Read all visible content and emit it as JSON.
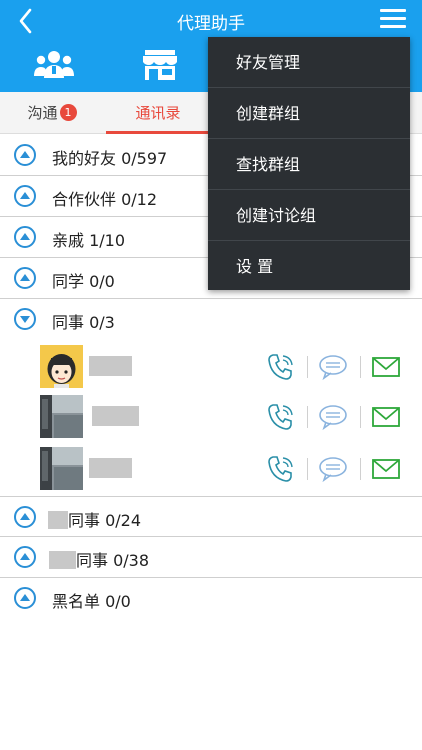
{
  "header": {
    "title": "代理助手"
  },
  "tabs": [
    {
      "label": "沟通",
      "badge": "1"
    },
    {
      "label": "通讯录"
    }
  ],
  "groups": [
    {
      "label": "我的好友 0/597",
      "expanded": false
    },
    {
      "label": "合作伙伴 0/12",
      "expanded": false
    },
    {
      "label": "亲戚 1/10",
      "expanded": false
    },
    {
      "label": "同学 0/0",
      "expanded": false
    },
    {
      "label": "同事 0/3",
      "expanded": true
    },
    {
      "label": "同事  0/24",
      "expanded": false
    },
    {
      "label": "同事 0/38",
      "expanded": false
    },
    {
      "label": "黑名单 0/0",
      "expanded": false
    }
  ],
  "menu": {
    "items": [
      "好友管理",
      "创建群组",
      "查找群组",
      "创建讨论组",
      "设 置"
    ]
  },
  "colors": {
    "header_bg": "#1aa0ee",
    "active_tab": "#e8493c",
    "menu_bg": "#2b2f33",
    "toggle_blue": "#2a8fd6",
    "phone_teal": "#2a8fa8",
    "chat_blue": "#8ab3de",
    "mail_green": "#2ea83a"
  }
}
